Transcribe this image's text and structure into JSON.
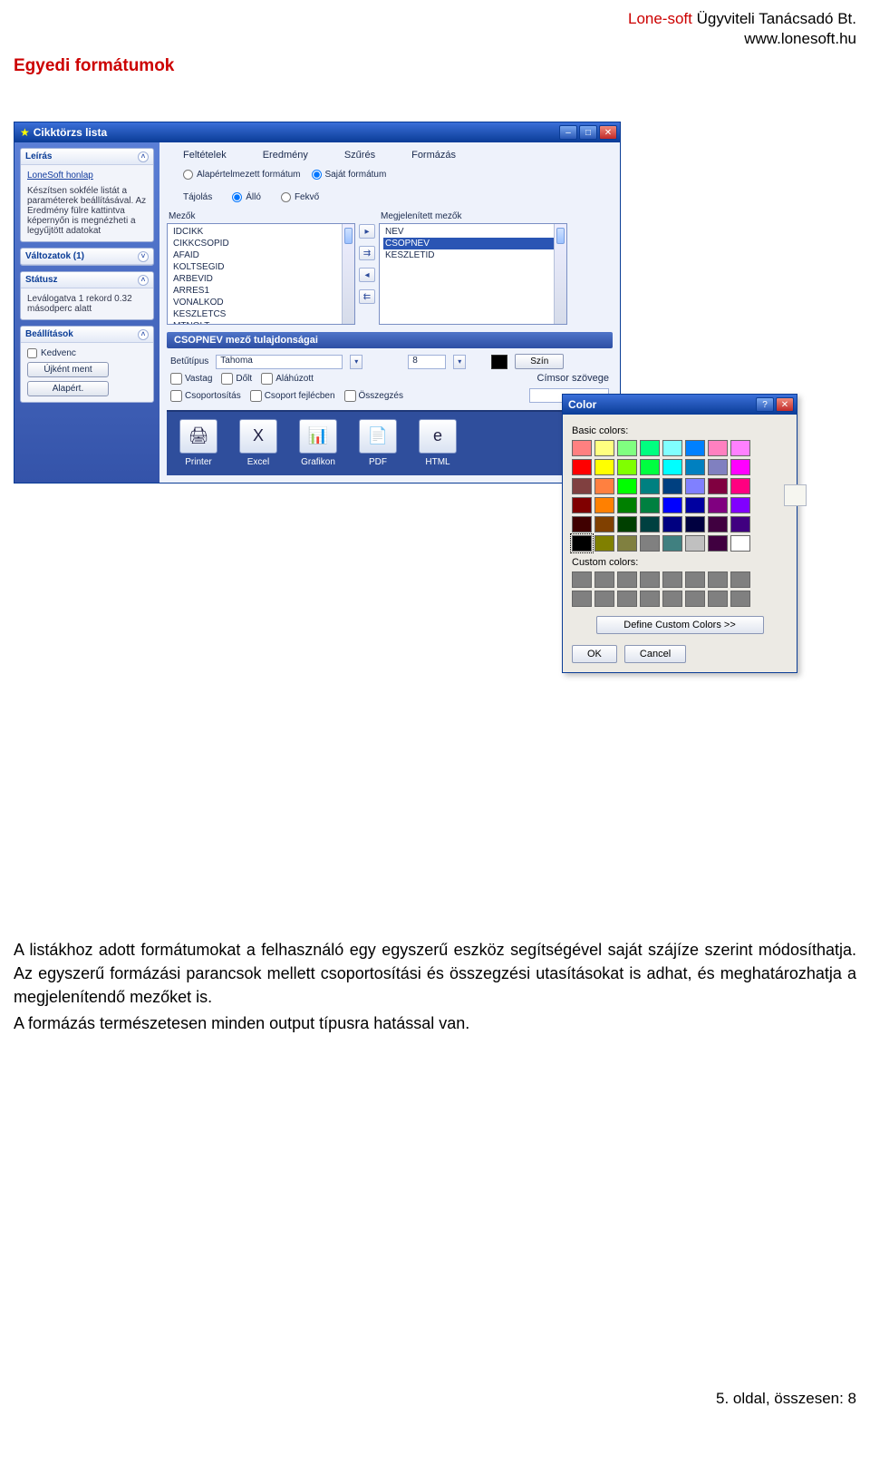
{
  "company": {
    "name_part1": "Lone-soft",
    "name_part2": " Ügyviteli Tanácsadó Bt.",
    "url": "www.lonesoft.hu"
  },
  "section_title": "Egyedi formátumok",
  "window": {
    "title": "Cikktörzs lista",
    "tabs": [
      "Feltételek",
      "Eredmény",
      "Szűrés",
      "Formázás"
    ],
    "active_tab": 3,
    "format_radio": {
      "default": "Alapértelmezett formátum",
      "custom": "Saját formátum"
    },
    "orientation": {
      "label": "Tájolás",
      "portrait": "Álló",
      "landscape": "Fekvő"
    },
    "fields_label": "Mezők",
    "visible_fields_label": "Megjelenített mezők",
    "fields": [
      "IDCIKK",
      "CIKKCSOPID",
      "AFAID",
      "KOLTSEGID",
      "ARBEVID",
      "ARRES1",
      "VONALKOD",
      "KESZLETCS",
      "MTNOLT"
    ],
    "visible_fields": [
      "NEV",
      "CSOPNEV",
      "KESZLETID"
    ],
    "selected_visible": 1,
    "prop_header": "CSOPNEV mező tulajdonságai",
    "font_label": "Betűtípus",
    "font_value": "Tahoma",
    "font_size": "8",
    "color_button": "Szín",
    "bold": "Vastag",
    "italic": "Dőlt",
    "underline": "Aláhúzott",
    "title_text_label": "Címsor szövege",
    "group": "Csoportosítás",
    "group_header": "Csoport fejlécben",
    "summary": "Összegzés",
    "outputs": [
      "Printer",
      "Excel",
      "Grafikon",
      "PDF",
      "HTML"
    ],
    "output_icons": [
      "🖨",
      "X",
      "📊",
      "📄",
      "e"
    ]
  },
  "sidebar": {
    "panes": {
      "leiras": {
        "title": "Leírás",
        "link": "LoneSoft honlap",
        "text": "Készítsen sokféle listát a paraméterek beállításával. Az Eredmény fülre kattintva képernyőn is megnézheti a legyűjtött adatokat"
      },
      "valtozatok": {
        "title": "Változatok (1)"
      },
      "status": {
        "title": "Státusz",
        "text": "Leválogatva 1 rekord 0.32 másodperc alatt"
      },
      "beallitasok": {
        "title": "Beállítások",
        "fav": "Kedvenc",
        "btn1": "Újként ment",
        "btn2": "Alapért."
      }
    }
  },
  "color_dialog": {
    "title": "Color",
    "basic_label": "Basic colors:",
    "custom_label": "Custom colors:",
    "basic_colors": [
      "#FF8080",
      "#FFFF80",
      "#80FF80",
      "#00FF80",
      "#80FFFF",
      "#0080FF",
      "#FF80C0",
      "#FF80FF",
      "#FF0000",
      "#FFFF00",
      "#80FF00",
      "#00FF40",
      "#00FFFF",
      "#0080C0",
      "#8080C0",
      "#FF00FF",
      "#804040",
      "#FF8040",
      "#00FF00",
      "#008080",
      "#004080",
      "#8080FF",
      "#800040",
      "#FF0080",
      "#800000",
      "#FF8000",
      "#008000",
      "#008040",
      "#0000FF",
      "#0000A0",
      "#800080",
      "#8000FF",
      "#400000",
      "#804000",
      "#004000",
      "#004040",
      "#000080",
      "#000040",
      "#400040",
      "#400080",
      "#000000",
      "#808000",
      "#808040",
      "#808080",
      "#408080",
      "#C0C0C0",
      "#400040",
      "#FFFFFF"
    ],
    "selected_basic": 40,
    "custom_colors": [
      "#808080",
      "#808080",
      "#808080",
      "#808080",
      "#808080",
      "#808080",
      "#808080",
      "#808080",
      "#808080",
      "#808080",
      "#808080",
      "#808080",
      "#808080",
      "#808080",
      "#808080",
      "#808080"
    ],
    "define_button": "Define Custom Colors >>",
    "ok": "OK",
    "cancel": "Cancel"
  },
  "body_paragraphs": [
    "A listákhoz adott formátumokat a felhasználó egy egyszerű eszköz segítségével saját szájíze szerint módosíthatja. Az egyszerű formázási parancsok mellett csoportosítási és összegzési utasításokat is adhat, és meghatározhatja a megjelenítendő mezőket is.",
    "A formázás természetesen minden output típusra hatással van."
  ],
  "footer": "5. oldal, összesen: 8"
}
